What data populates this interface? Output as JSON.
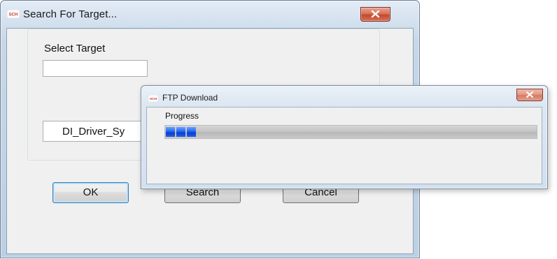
{
  "search_dialog": {
    "title": "Search For Target...",
    "icon": "sch-app-icon",
    "close_icon": "close-icon",
    "select_label": "Select Target",
    "target_input_value": "",
    "driver_value": "DI_Driver_Sy",
    "ok_label": "OK",
    "search_label": "Search",
    "cancel_label": "Cancel"
  },
  "ftp_dialog": {
    "title": "FTP Download",
    "icon": "sch-app-icon",
    "close_icon": "close-icon",
    "progress_label": "Progress",
    "progress_fraction": 0.08
  },
  "colors": {
    "progress_fill": "#1f5ee8",
    "close_button": "#c24a2c",
    "default_button_border": "#3c7fb1"
  }
}
